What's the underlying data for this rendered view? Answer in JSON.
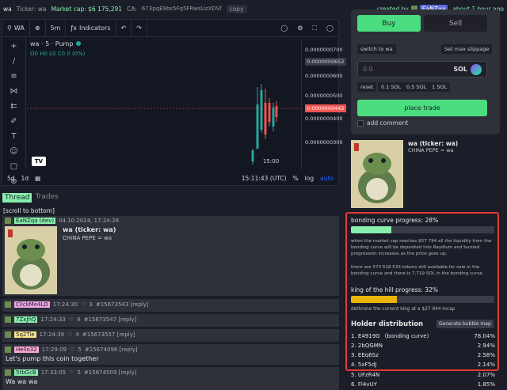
{
  "topbar": {
    "name": "wa",
    "ticker": "Ticker: wa",
    "market_cap": "Market cap: $6 175,291",
    "ca_label": "CA:",
    "ca_value": "673pqE9bs5Fq5FRwsUzXDSf",
    "copy": "copy",
    "created_by": "created by",
    "creator": "EaNZqa",
    "ago": "about 1 hour ago"
  },
  "chart": {
    "symbol": "WA",
    "interval": "5m",
    "indicators": "Indicators",
    "legend": "wa · 5 · Pump",
    "ohlc": "O0 H0 L0 C0 0 (0%)",
    "price_labels": [
      "0.0000000700",
      "0.0000000652",
      "0.0000000600",
      "0.0000000500",
      "0.0000000442",
      "0.0000000400",
      "0.0000000300"
    ],
    "time_label": "15:00",
    "range_5d": "5d",
    "range_1d": "1d",
    "clock": "15:11:43 (UTC)",
    "pct": "%",
    "log": "log",
    "auto": "auto"
  },
  "tabs": {
    "thread": "Thread",
    "trades": "Trades"
  },
  "scroll_bottom": "[scroll to bottom]",
  "op": {
    "user": "EaNZqa (dev)",
    "time": "04.10.2024, 17:24:28",
    "title": "wa (ticker: wa)",
    "desc": "CHINA PEPE = wa"
  },
  "posts": [
    {
      "user": "ClickMe4LO",
      "time": "17:24:30",
      "likes": "3",
      "id": "#15673543 [reply]",
      "body": "",
      "color": "#f0a6e8"
    },
    {
      "user": "7ZxJhQ",
      "time": "17:24:33",
      "likes": "4",
      "id": "#15673547 [reply]",
      "body": "",
      "color": "#86efac"
    },
    {
      "user": "5q2Tie",
      "time": "17:24:39",
      "likes": "4",
      "id": "#15673557 [reply]",
      "body": "",
      "color": "#fde68a"
    },
    {
      "user": "Hello32",
      "time": "17:29:09",
      "likes": "5",
      "id": "#15674096 [reply]",
      "body": "Let's pump this coin together",
      "color": "#f9a8d4"
    },
    {
      "user": "5tbGcB",
      "time": "17:33:05",
      "likes": "5",
      "id": "#15674509 [reply]",
      "body": "Wa wa wa",
      "color": "#86efac"
    }
  ],
  "trade": {
    "buy": "Buy",
    "sell": "Sell",
    "switch": "switch to wa",
    "slippage": "Set max slippage",
    "amount_placeholder": "0.0",
    "unit": "SOL",
    "quick": [
      "reset",
      "0.1 SOL",
      "0.5 SOL",
      "1 SOL"
    ],
    "place": "place trade",
    "add_comment": "add comment"
  },
  "token": {
    "name": "wa (ticker: wa)",
    "desc": "CHINA PEPE = wa"
  },
  "bonding": {
    "title": "bonding curve progress: 28%",
    "progress": 0.28,
    "para1": "when the market cap reaches $57 794 all the liquidity from the bonding curve will be deposited into Raydium and burned. progression increases as the price goes up.",
    "para2": "there are 573 518 533 tokens still available for sale in the bonding curve and there is 7,719 SOL in the bonding curve.",
    "koth_title": "king of the hill progress: 32%",
    "koth_progress": 0.32,
    "dethrone": "dethrone the current king at a $27 944 mcap",
    "holders_title": "Holder distribution",
    "bubble": "Generate bubble map",
    "holders": [
      {
        "rank": "1. E4919G",
        "tag": "(bonding curve)",
        "pct": "78.04%"
      },
      {
        "rank": "2. 2bQGMN",
        "tag": "",
        "pct": "2.94%"
      },
      {
        "rank": "3. EEq6Sz",
        "tag": "",
        "pct": "2.58%"
      },
      {
        "rank": "4. 5xF5dJ",
        "tag": "",
        "pct": "2.14%"
      },
      {
        "rank": "5. UFzR4N",
        "tag": "",
        "pct": "2.07%"
      },
      {
        "rank": "6. Fl4vUY",
        "tag": "",
        "pct": "1.85%"
      }
    ]
  },
  "colors": {
    "green": "#86efac",
    "accent": "#4ade80",
    "red": "#e53935",
    "koth": "#eab308"
  }
}
